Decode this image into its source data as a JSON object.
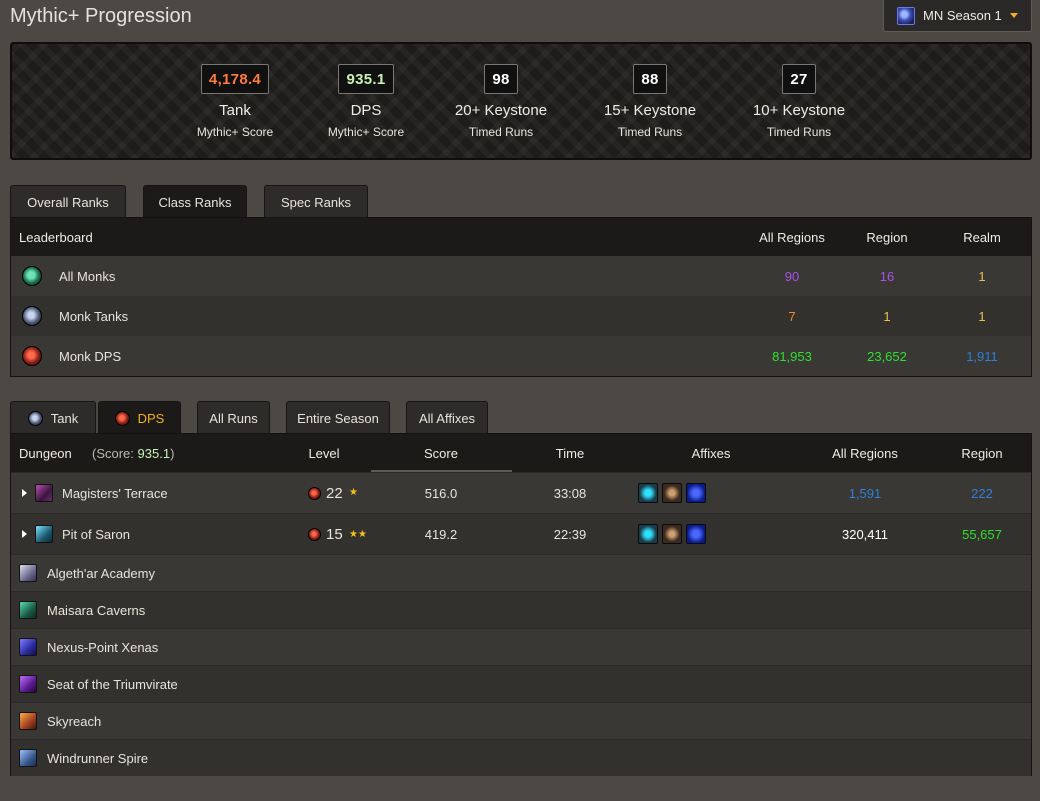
{
  "header": {
    "title": "Mythic+ Progression",
    "season": "MN Season 1"
  },
  "stats": [
    {
      "value": "4,178.4",
      "color": "#ff7a3d",
      "label": "Tank",
      "sub": "Mythic+ Score"
    },
    {
      "value": "935.1",
      "color": "#c9f2b4",
      "label": "DPS",
      "sub": "Mythic+ Score"
    },
    {
      "value": "98",
      "color": "#ffffff",
      "label": "20+ Keystone",
      "sub": "Timed Runs"
    },
    {
      "value": "88",
      "color": "#ffffff",
      "label": "15+ Keystone",
      "sub": "Timed Runs"
    },
    {
      "value": "27",
      "color": "#ffffff",
      "label": "10+ Keystone",
      "sub": "Timed Runs"
    }
  ],
  "rank_tabs": [
    "Overall Ranks",
    "Class Ranks",
    "Spec Ranks"
  ],
  "rank_tabs_active": "Class Ranks",
  "ranks": {
    "columns": [
      "Leaderboard",
      "All Regions",
      "Region",
      "Realm"
    ],
    "rows": [
      {
        "name": "All Monks",
        "icon": "monk-all-icon",
        "all_regions": "90",
        "region": "16",
        "realm": "1"
      },
      {
        "name": "Monk Tanks",
        "icon": "monk-tank-icon",
        "all_regions": "7",
        "region": "1",
        "realm": "1"
      },
      {
        "name": "Monk DPS",
        "icon": "monk-dps-icon",
        "all_regions": "81,953",
        "region": "23,652",
        "realm": "1,911"
      }
    ]
  },
  "run_tabs": [
    "Tank",
    "DPS",
    "All Runs",
    "Entire Season",
    "All Affixes"
  ],
  "run_tabs_active": "DPS",
  "runs": {
    "columns": {
      "dungeon": "Dungeon",
      "score_prefix": "(Score: ",
      "score_value": "935.1",
      "score_suffix": ")",
      "level": "Level",
      "score": "Score",
      "time": "Time",
      "affixes": "Affixes",
      "all_regions": "All Regions",
      "region": "Region"
    },
    "rows": [
      {
        "dungeon": "Magisters' Terrace",
        "level": "22",
        "stars": "★",
        "score": "516.0",
        "time": "33:08",
        "all_regions": "1,591",
        "region": "222"
      },
      {
        "dungeon": "Pit of Saron",
        "level": "15",
        "stars": "★★",
        "score": "419.2",
        "time": "22:39",
        "all_regions": "320,411",
        "region": "55,657"
      }
    ],
    "unplayed": [
      "Algeth'ar Academy",
      "Maisara Caverns",
      "Nexus-Point Xenas",
      "Seat of the Triumvirate",
      "Skyreach",
      "Windrunner Spire"
    ]
  }
}
